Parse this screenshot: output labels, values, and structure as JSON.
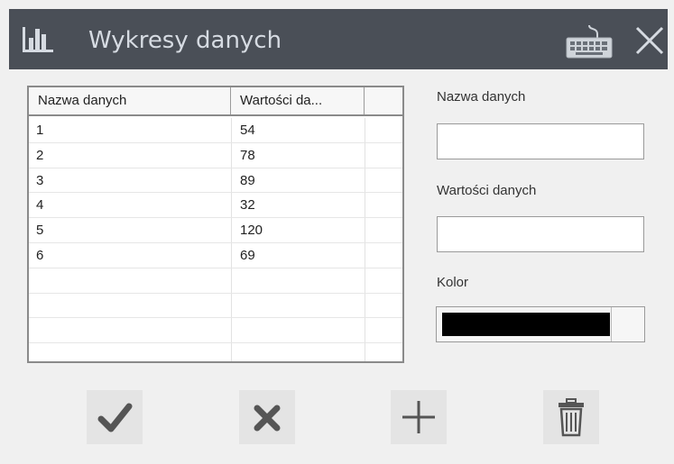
{
  "window": {
    "title": "Wykresy danych",
    "icons": {
      "app": "bar-chart-icon",
      "keyboard": "keyboard-icon",
      "close": "close-icon"
    }
  },
  "table": {
    "columns": [
      "Nazwa danych",
      "Wartości da...",
      ""
    ],
    "rows": [
      {
        "name": "1",
        "value": "54"
      },
      {
        "name": "2",
        "value": "78"
      },
      {
        "name": "3",
        "value": "89"
      },
      {
        "name": "4",
        "value": "32"
      },
      {
        "name": "5",
        "value": "120"
      },
      {
        "name": "6",
        "value": "69"
      },
      {
        "name": "",
        "value": ""
      },
      {
        "name": "",
        "value": ""
      },
      {
        "name": "",
        "value": ""
      }
    ]
  },
  "form": {
    "name_label": "Nazwa danych",
    "name_value": "",
    "value_label": "Wartości danych",
    "value_value": "",
    "color_label": "Kolor",
    "color_value": "#000000"
  },
  "actions": [
    {
      "icon": "check-icon",
      "color": "#555555"
    },
    {
      "icon": "x-icon",
      "color": "#555555"
    },
    {
      "icon": "plus-icon",
      "color": "#555555"
    },
    {
      "icon": "trash-icon",
      "color": "#555555"
    }
  ],
  "colors": {
    "titlebar": "#4a4f57",
    "title_text": "#d6dbe2",
    "background": "#f0f0f0"
  }
}
